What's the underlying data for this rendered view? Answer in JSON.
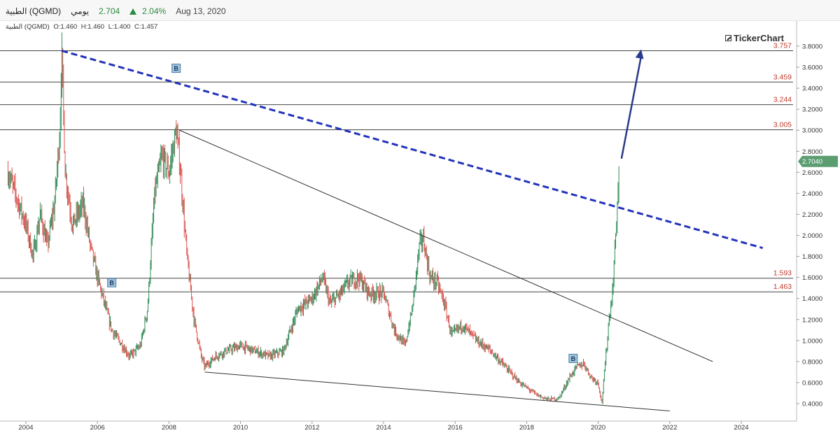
{
  "header": {
    "symbol": "الطبية (QGMD)",
    "period": "يومي",
    "price": "2.704",
    "change": "2.04%",
    "date": "Aug 13, 2020"
  },
  "ohlc": {
    "name": "الطبية (QGMD)",
    "open": "O:1.460",
    "high": "H:1.460",
    "low": "L:1.400",
    "close": "C:1.457"
  },
  "brand": "TickerChart",
  "colors": {
    "up": "#2e8b57",
    "down": "#d9534f",
    "trend": "#2233bb",
    "level": "#c0392b",
    "price_tag": "#5c9e72"
  },
  "chart_data": {
    "type": "line",
    "xlim": [
      2003.5,
      2025.5
    ],
    "ylim": [
      0.3,
      3.9
    ],
    "x_ticks": [
      "2004",
      "2006",
      "2008",
      "2010",
      "2012",
      "2014",
      "2016",
      "2018",
      "2020",
      "2022",
      "2024"
    ],
    "y_ticks": [
      "3.8000",
      "3.6000",
      "3.4000",
      "3.2000",
      "3.0000",
      "2.8000",
      "2.6000",
      "2.4000",
      "2.2000",
      "2.0000",
      "1.8000",
      "1.6000",
      "1.4000",
      "1.2000",
      "1.0000",
      "0.8000",
      "0.6000",
      "0.4000"
    ],
    "series": [
      {
        "x": [
          2003.5,
          2003.8,
          2004.0,
          2004.2,
          2004.4,
          2004.6,
          2004.8,
          2004.95,
          2005.0,
          2005.1,
          2005.3,
          2005.6,
          2005.8,
          2006.0,
          2006.2,
          2006.4,
          2006.6,
          2006.9,
          2007.2,
          2007.4,
          2007.6,
          2007.8,
          2008.0,
          2008.2,
          2008.3,
          2008.5,
          2008.7,
          2008.9,
          2009.0,
          2009.3,
          2009.6,
          2010.0,
          2010.4,
          2010.8,
          2011.2,
          2011.6,
          2012.0,
          2012.3,
          2012.5,
          2012.8,
          2013.0,
          2013.3,
          2013.6,
          2014.0,
          2014.3,
          2014.6,
          2014.8,
          2015.0,
          2015.1,
          2015.3,
          2015.5,
          2015.7,
          2015.9,
          2016.2,
          2016.6,
          2017.0,
          2017.4,
          2017.8,
          2018.0,
          2018.3,
          2018.6,
          2018.9,
          2019.2,
          2019.4,
          2019.6,
          2019.8,
          2020.0,
          2020.1,
          2020.2,
          2020.3,
          2020.4,
          2020.5,
          2020.6
        ],
        "y": [
          2.6,
          2.3,
          2.1,
          1.8,
          2.2,
          1.9,
          2.3,
          3.0,
          3.757,
          2.6,
          2.1,
          2.3,
          1.9,
          1.6,
          1.35,
          1.1,
          1.0,
          0.85,
          0.95,
          1.3,
          2.4,
          2.75,
          2.6,
          3.0,
          2.7,
          1.8,
          1.2,
          0.85,
          0.75,
          0.85,
          0.9,
          0.95,
          0.9,
          0.85,
          0.9,
          1.3,
          1.4,
          1.6,
          1.35,
          1.45,
          1.55,
          1.6,
          1.45,
          1.45,
          1.1,
          0.95,
          1.3,
          1.9,
          1.98,
          1.6,
          1.55,
          1.35,
          1.05,
          1.15,
          1.0,
          0.9,
          0.75,
          0.6,
          0.55,
          0.48,
          0.44,
          0.45,
          0.65,
          0.75,
          0.78,
          0.65,
          0.6,
          0.4,
          0.8,
          1.2,
          1.46,
          2.1,
          2.704
        ]
      }
    ],
    "levels": [
      {
        "value": 3.757,
        "label": "3.757"
      },
      {
        "value": 3.459,
        "label": "3.459"
      },
      {
        "value": 3.244,
        "label": "3.244"
      },
      {
        "value": 3.005,
        "label": "3.005"
      },
      {
        "value": 1.593,
        "label": "1.593"
      },
      {
        "value": 1.463,
        "label": "1.463"
      }
    ],
    "trendlines": [
      {
        "style": "dashed-blue",
        "x1": 2005.0,
        "y1": 3.757,
        "x2": 2024.6,
        "y2": 1.88
      },
      {
        "style": "thin",
        "x1": 2008.3,
        "y1": 3.0,
        "x2": 2023.2,
        "y2": 0.8
      },
      {
        "style": "thin",
        "x1": 2009.0,
        "y1": 0.7,
        "x2": 2022.0,
        "y2": 0.33
      }
    ],
    "arrow": {
      "x1": 2020.65,
      "y1": 2.73,
      "x2": 2021.2,
      "y2": 3.77
    },
    "markers": [
      {
        "x": 2008.2,
        "y": 3.59,
        "label": "B"
      },
      {
        "x": 2006.4,
        "y": 1.55,
        "label": "B"
      },
      {
        "x": 2019.3,
        "y": 0.83,
        "label": "B"
      }
    ],
    "last_price": {
      "value": 2.704,
      "label": "2.7040"
    }
  }
}
